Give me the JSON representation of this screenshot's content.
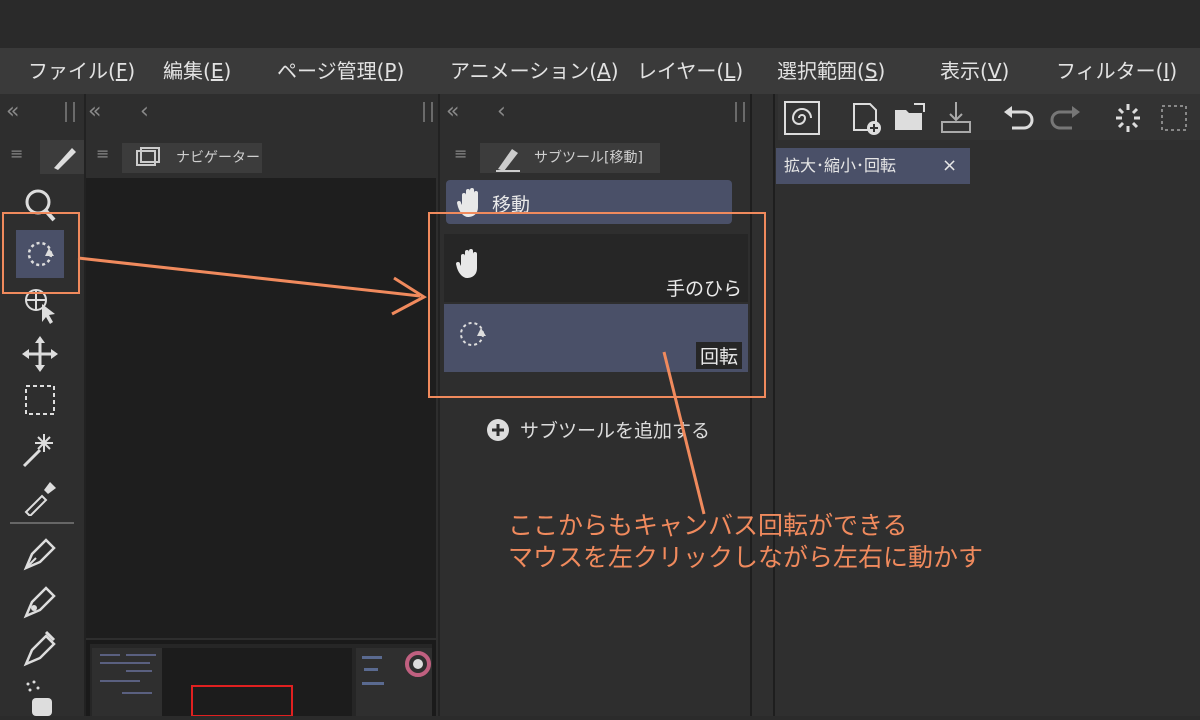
{
  "menu": {
    "items": [
      {
        "label": "ファイル(",
        "key": "F",
        "tail": ")"
      },
      {
        "label": "編集(",
        "key": "E",
        "tail": ")"
      },
      {
        "label": "ページ管理(",
        "key": "P",
        "tail": ")"
      },
      {
        "label": "アニメーション(",
        "key": "A",
        "tail": ")"
      },
      {
        "label": "レイヤー(",
        "key": "L",
        "tail": ")"
      },
      {
        "label": "選択範囲(",
        "key": "S",
        "tail": ")"
      },
      {
        "label": "表示(",
        "key": "V",
        "tail": ")"
      },
      {
        "label": "フィルター(",
        "key": "I",
        "tail": ")"
      }
    ]
  },
  "panels": {
    "navigator_tab": "ナビゲーター",
    "subtool_tab": "サブツール[移動]",
    "right_tab": "拡大･縮小･回転",
    "right_tab_close": "×"
  },
  "subtool": {
    "group_label": "移動",
    "items": [
      {
        "label": "手のひら",
        "icon": "hand-icon"
      },
      {
        "label": "回転",
        "icon": "rotate-icon",
        "selected": true
      }
    ],
    "add_label": "サブツールを追加する"
  },
  "annotation": {
    "line1": "ここからもキャンバス回転ができる",
    "line2": "マウスを左クリックしながら左右に動かす",
    "color": "#f08a5d"
  },
  "colors": {
    "selected_bg": "#4a5068",
    "accent_orange": "#f08a5d"
  }
}
